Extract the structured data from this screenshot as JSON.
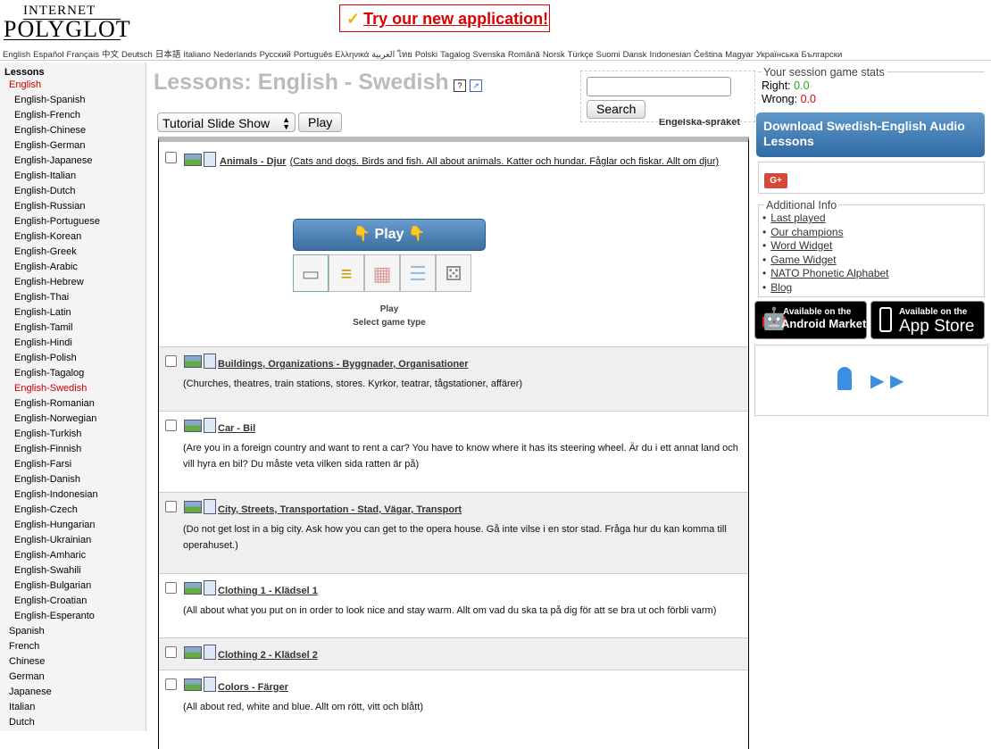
{
  "logo": {
    "line1": "INTERNET",
    "line2": "POLYGLOT"
  },
  "promo": {
    "label": "Try our new application!"
  },
  "languages": [
    "English",
    "Español",
    "Français",
    "中文",
    "Deutsch",
    "日本語",
    "Italiano",
    "Nederlands",
    "Русский",
    "Português",
    "Ελληνικά",
    "العربية",
    "ไทย",
    "Polski",
    "Tagalog",
    "Svenska",
    "Română",
    "Norsk",
    "Türkçe",
    "Suomi",
    "Dansk",
    "Indonesian",
    "Čeština",
    "Magyar",
    "Українська",
    "Български"
  ],
  "sidebar": {
    "heading": "Lessons",
    "current_language": "English",
    "sub_items": [
      "English-Spanish",
      "English-French",
      "English-Chinese",
      "English-German",
      "English-Japanese",
      "English-Italian",
      "English-Dutch",
      "English-Russian",
      "English-Portuguese",
      "English-Korean",
      "English-Greek",
      "English-Arabic",
      "English-Hebrew",
      "English-Thai",
      "English-Latin",
      "English-Tamil",
      "English-Hindi",
      "English-Polish",
      "English-Tagalog",
      "English-Swedish",
      "English-Romanian",
      "English-Norwegian",
      "English-Turkish",
      "English-Finnish",
      "English-Farsi",
      "English-Danish",
      "English-Indonesian",
      "English-Czech",
      "English-Hungarian",
      "English-Ukrainian",
      "English-Amharic",
      "English-Swahili",
      "English-Bulgarian",
      "English-Croatian",
      "English-Esperanto"
    ],
    "active_sub": "English-Swedish",
    "other_languages": [
      "Spanish",
      "French",
      "Chinese",
      "German",
      "Japanese",
      "Italian",
      "Dutch"
    ]
  },
  "main": {
    "title": "Lessons: English - Swedish",
    "mode_select": "Tutorial Slide Show",
    "play_label": "Play",
    "search_placeholder": "",
    "search_label": "Search",
    "lang_label": "Engelska-språket"
  },
  "game": {
    "play_label": "Play",
    "caption_1": "Play",
    "caption_2": "Select game type"
  },
  "lessons": [
    {
      "title": "Animals - Djur",
      "desc": "(Cats and dogs. Birds and fish. All about animals. Katter och hundar. Fåglar och fiskar. Allt om djur)"
    },
    {
      "title": "Buildings, Organizations - Byggnader, Organisationer",
      "desc": "(Churches, theatres, train stations, stores. Kyrkor, teatrar, tågstationer, affärer)"
    },
    {
      "title": "Car - Bil",
      "desc": "(Are you in a foreign country and want to rent a car? You have to know where it has its steering wheel. Är du i ett annat land och vill hyra en bil? Du måste veta vilken sida ratten är på)"
    },
    {
      "title": "City, Streets, Transportation - Stad, Vägar, Transport",
      "desc": "(Do not get lost in a big city. Ask how you can get to the opera house. Gå inte vilse i en stor stad. Fråga hur du kan komma till operahuset.)"
    },
    {
      "title": "Clothing 1 - Klädsel 1",
      "desc": "(All about what you put on in order to look nice and stay warm. Allt om vad du ska ta på dig för att se bra ut och förbli varm)"
    },
    {
      "title": "Clothing 2 - Klädsel 2",
      "desc": ""
    },
    {
      "title": "Colors - Färger",
      "desc": "(All about red, white and blue. Allt om rött, vitt och blått)"
    }
  ],
  "stats": {
    "legend": "Your session game stats",
    "right_label": "Right:",
    "right_value": "0.0",
    "wrong_label": "Wrong:",
    "wrong_value": "0.0"
  },
  "download": {
    "label": "Download Swedish-English Audio Lessons"
  },
  "additional": {
    "legend": "Additional Info",
    "items": [
      "Last played",
      "Our champions",
      "Word Widget",
      "Game Widget",
      "NATO Phonetic Alphabet",
      "Blog"
    ]
  },
  "stores": {
    "android_line1": "Available on the",
    "android_line2": "Android Market",
    "apple_line1": "Available on the",
    "apple_line2": "App Store"
  },
  "colors": {
    "accent_red": "#cc0000",
    "button_blue": "#3a6fa0",
    "right_green": "#22aa22"
  }
}
